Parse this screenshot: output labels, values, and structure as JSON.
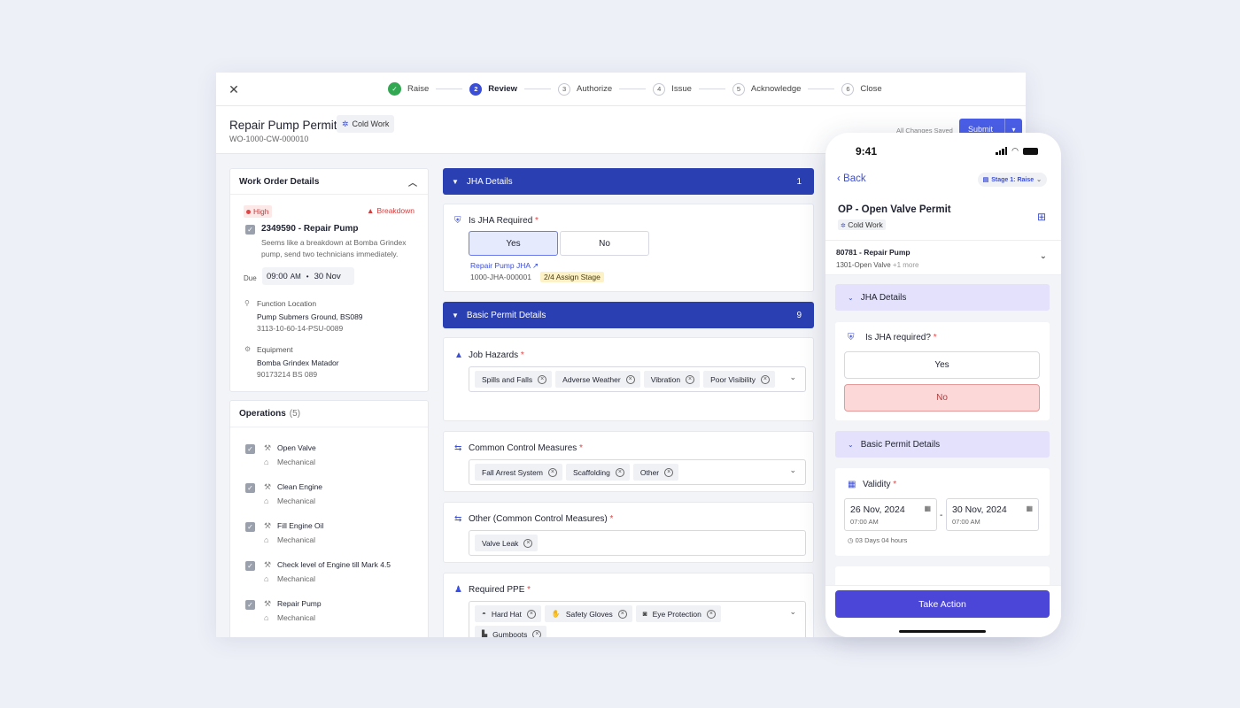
{
  "stepper": {
    "steps": [
      {
        "num": "✓",
        "label": "Raise"
      },
      {
        "num": "2",
        "label": "Review"
      },
      {
        "num": "3",
        "label": "Authorize"
      },
      {
        "num": "4",
        "label": "Issue"
      },
      {
        "num": "5",
        "label": "Acknowledge"
      },
      {
        "num": "6",
        "label": "Close"
      }
    ]
  },
  "header": {
    "title": "Repair Pump Permit",
    "chip": "Cold Work",
    "id": "WO-1000-CW-000010",
    "saved": "All Changes Saved",
    "submit": "Submit"
  },
  "work_order": {
    "heading": "Work Order Details",
    "priority": "High",
    "type": "Breakdown",
    "title": "2349590 - Repair Pump",
    "description": "Seems like a breakdown at Bomba Grindex pump, send two technicians immediately.",
    "due_label": "Due",
    "due_time": "09:00",
    "due_ampm": "AM",
    "due_date": "30 Nov",
    "function_location_label": "Function Location",
    "function_location_value": "Pump Submers Ground, BS089",
    "function_location_code": "3113-10-60-14-PSU-0089",
    "equipment_label": "Equipment",
    "equipment_value": "Bomba Grindex Matador",
    "equipment_code": "90173214 BS 089"
  },
  "operations": {
    "heading": "Operations",
    "count": "(5)",
    "items": [
      {
        "name": "Open Valve",
        "type": "Mechanical"
      },
      {
        "name": "Clean Engine",
        "type": "Mechanical"
      },
      {
        "name": "Fill Engine Oil",
        "type": "Mechanical"
      },
      {
        "name": "Check level of Engine till Mark 4.5",
        "type": "Mechanical"
      },
      {
        "name": "Repair Pump",
        "type": "Mechanical"
      }
    ]
  },
  "jha": {
    "heading": "JHA Details",
    "count": "1",
    "question": "Is JHA Required",
    "yes": "Yes",
    "no": "No",
    "link": "Repair Pump JHA",
    "id": "1000-JHA-000001",
    "stage": "2/4 Assign Stage"
  },
  "basic": {
    "heading": "Basic Permit Details",
    "count": "9",
    "job_hazards_label": "Job Hazards",
    "job_hazards": [
      "Spills and Falls",
      "Adverse Weather",
      "Vibration",
      "Poor Visibility"
    ],
    "controls_label": "Common Control Measures",
    "controls": [
      "Fall Arrest System",
      "Scaffolding",
      "Other"
    ],
    "other_label": "Other (Common Control Measures)",
    "other": [
      "Valve Leak"
    ],
    "ppe_label": "Required PPE",
    "ppe": [
      "Hard Hat",
      "Safety Gloves",
      "Eye Protection",
      "Gumboots"
    ]
  },
  "phone": {
    "time": "9:41",
    "back": "Back",
    "stage": "Stage 1: Raise",
    "title": "OP - Open Valve Permit",
    "chip": "Cold Work",
    "wo_title": "80781 - Repair Pump",
    "wo_sub": "1301-Open Valve",
    "wo_more": "+1 more",
    "jha_heading": "JHA Details",
    "jha_question": "Is JHA required?",
    "yes": "Yes",
    "no": "No",
    "basic_heading": "Basic Permit Details",
    "validity_label": "Validity",
    "start_date": "26 Nov, 2024",
    "start_time": "07:00 AM",
    "end_date": "30 Nov, 2024",
    "end_time": "07:00 AM",
    "duration": "03 Days 04 hours",
    "action": "Take Action"
  },
  "colors": {
    "accent": "#3b4ed8",
    "section_header": "#2a3fb2",
    "success": "#33a852",
    "danger": "#e04646",
    "phone_button": "#4c46d8"
  }
}
